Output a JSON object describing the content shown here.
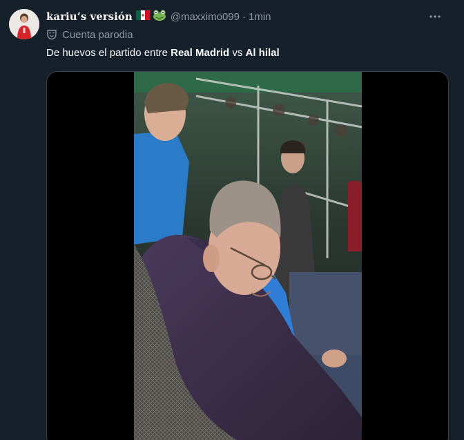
{
  "tweet": {
    "display_name": "kariu’s versión",
    "handle": "@maxximo099",
    "separator": "·",
    "time": "1min",
    "parody_label": "Cuenta parodia",
    "text_parts": {
      "prefix": "De huevos el partido entre ",
      "team1": "Real Madrid",
      "middle": " vs ",
      "team2": "Al hilal"
    },
    "icons": {
      "flag": "mexico-flag-icon",
      "frog": "frog-icon",
      "more": "more-icon",
      "parody": "mask-icon"
    }
  },
  "colors": {
    "background": "#15202b",
    "text": "#f7f9f9",
    "secondary": "#8b98a5",
    "border": "#38444d"
  }
}
